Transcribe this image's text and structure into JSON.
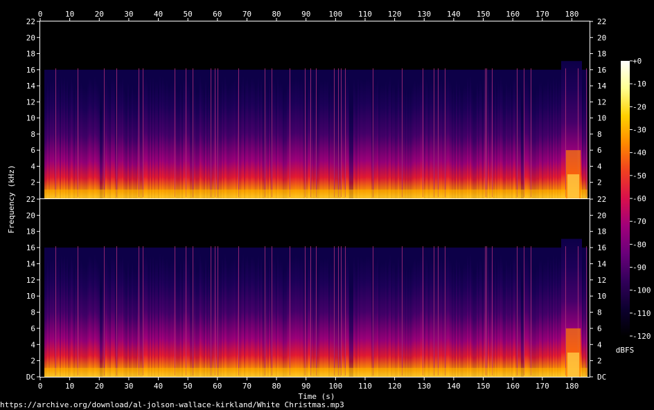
{
  "chart_data": {
    "type": "heatmap",
    "title": "",
    "xlabel": "Time (s)",
    "ylabel": "Frequency (kHz)",
    "xlim": [
      0,
      186
    ],
    "x_ticks": [
      0,
      10,
      20,
      30,
      40,
      50,
      60,
      70,
      80,
      90,
      100,
      110,
      120,
      130,
      140,
      150,
      160,
      170,
      180
    ],
    "ylim_khz": [
      0,
      22
    ],
    "y_ticks": [
      "DC",
      "2",
      "4",
      "6",
      "8",
      "10",
      "12",
      "14",
      "16",
      "18",
      "20",
      "22"
    ],
    "channels": 2,
    "lowpass_cutoff_khz": 16,
    "colorbar": {
      "label": "dBFS",
      "range": [
        -120,
        0
      ],
      "ticks": [
        "+0",
        "-10",
        "-20",
        "-30",
        "-40",
        "-50",
        "-60",
        "-70",
        "-80",
        "-90",
        "-100",
        "-110",
        "-120"
      ],
      "colormap": [
        "#000000",
        "#0d0030",
        "#32005a",
        "#6a007a",
        "#a0007a",
        "#d8104c",
        "#f04020",
        "#ff8a00",
        "#ffd000",
        "#ffff90",
        "#ffffff"
      ]
    },
    "background": "#000000",
    "axis_color": "#ffffff"
  },
  "footer": {
    "source_url": "https://archive.org/download/al-jolson-wallace-kirkland/White Christmas.mp3"
  }
}
